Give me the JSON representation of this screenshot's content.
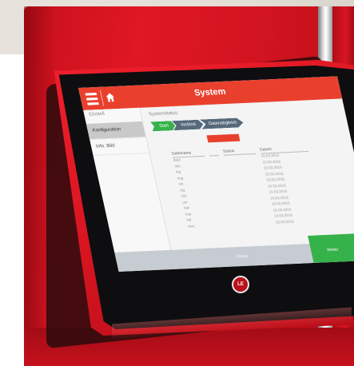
{
  "photo": {
    "subject": "red machine with tablet touchscreen",
    "colors": {
      "machine_red": "#d81521",
      "ui_accent_red": "#e9402e",
      "ui_green": "#36b24a",
      "ui_step_grey": "#56697a",
      "bezel": "#0e0e10"
    }
  },
  "screen": {
    "title": "System",
    "menu_icon": "hamburger-icon",
    "home_icon": "home-icon",
    "sidebar": {
      "heading": "Einstell",
      "items": [
        "Konfiguration",
        "Info. Bild"
      ]
    },
    "content": {
      "section_label": "Systemstatus",
      "steps": [
        "Start",
        "Verbind.",
        "Datenabgleich"
      ],
      "table": {
        "headers": [
          "Dateiname",
          "Status",
          "Datum"
        ],
        "rows": [
          [
            "data",
            "",
            "10.03.2016"
          ],
          [
            "info",
            "",
            "10.03.2016"
          ],
          [
            "log",
            "",
            "10.03.2016"
          ],
          [
            "img",
            "",
            "10.03.2016"
          ],
          [
            "set",
            "",
            "10.03.2016"
          ],
          [
            "cfg",
            "",
            "10.03.2016"
          ],
          [
            "sys",
            "",
            "10.03.2016"
          ],
          [
            "usr",
            "",
            "10.03.2016"
          ],
          [
            "bak",
            "",
            "10.03.2016"
          ],
          [
            "tmp",
            "",
            "10.03.2016"
          ],
          [
            "old",
            "",
            "10.03.2016"
          ],
          [
            "new",
            "",
            "10.03.2016"
          ]
        ]
      }
    },
    "bottom": {
      "label": "Status",
      "continue_label": "Weiter"
    }
  },
  "logo": {
    "text": "LE"
  }
}
